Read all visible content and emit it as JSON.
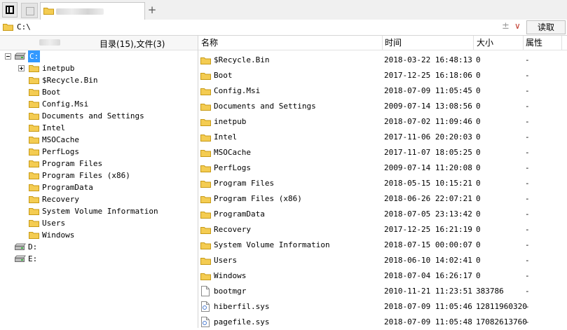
{
  "address": {
    "path": "C:\\",
    "read_button": "读取",
    "sort_glyph": "±",
    "dropdown_glyph": "∨"
  },
  "tabs": {
    "new_tab": "+"
  },
  "left_pane": {
    "summary": "目录(15),文件(3)",
    "tree": [
      {
        "label": "C:",
        "type": "drive",
        "level": 0,
        "expander": "minus",
        "selected": true
      },
      {
        "label": "inetpub",
        "type": "folder",
        "level": 1,
        "expander": "plus"
      },
      {
        "label": "$Recycle.Bin",
        "type": "folder",
        "level": 1
      },
      {
        "label": "Boot",
        "type": "folder",
        "level": 1
      },
      {
        "label": "Config.Msi",
        "type": "folder",
        "level": 1
      },
      {
        "label": "Documents and Settings",
        "type": "folder",
        "level": 1
      },
      {
        "label": "Intel",
        "type": "folder",
        "level": 1
      },
      {
        "label": "MSOCache",
        "type": "folder",
        "level": 1
      },
      {
        "label": "PerfLogs",
        "type": "folder",
        "level": 1
      },
      {
        "label": "Program Files",
        "type": "folder",
        "level": 1
      },
      {
        "label": "Program Files (x86)",
        "type": "folder",
        "level": 1
      },
      {
        "label": "ProgramData",
        "type": "folder",
        "level": 1
      },
      {
        "label": "Recovery",
        "type": "folder",
        "level": 1
      },
      {
        "label": "System Volume Information",
        "type": "folder",
        "level": 1
      },
      {
        "label": "Users",
        "type": "folder",
        "level": 1
      },
      {
        "label": "Windows",
        "type": "folder",
        "level": 1
      },
      {
        "label": "D:",
        "type": "drive",
        "level": 0
      },
      {
        "label": "E:",
        "type": "drive",
        "level": 0
      }
    ]
  },
  "file_list": {
    "columns": {
      "name": "名称",
      "time": "时间",
      "size": "大小",
      "attr": "属性"
    },
    "rows": [
      {
        "name": "$Recycle.Bin",
        "time": "2018-03-22 16:48:13",
        "size": "0",
        "attr": "-",
        "type": "folder"
      },
      {
        "name": "Boot",
        "time": "2017-12-25 16:18:06",
        "size": "0",
        "attr": "-",
        "type": "folder"
      },
      {
        "name": "Config.Msi",
        "time": "2018-07-09 11:05:45",
        "size": "0",
        "attr": "-",
        "type": "folder"
      },
      {
        "name": "Documents and Settings",
        "time": "2009-07-14 13:08:56",
        "size": "0",
        "attr": "-",
        "type": "folder"
      },
      {
        "name": "inetpub",
        "time": "2018-07-02 11:09:46",
        "size": "0",
        "attr": "-",
        "type": "folder"
      },
      {
        "name": "Intel",
        "time": "2017-11-06 20:20:03",
        "size": "0",
        "attr": "-",
        "type": "folder"
      },
      {
        "name": "MSOCache",
        "time": "2017-11-07 18:05:25",
        "size": "0",
        "attr": "-",
        "type": "folder"
      },
      {
        "name": "PerfLogs",
        "time": "2009-07-14 11:20:08",
        "size": "0",
        "attr": "-",
        "type": "folder"
      },
      {
        "name": "Program Files",
        "time": "2018-05-15 10:15:21",
        "size": "0",
        "attr": "-",
        "type": "folder"
      },
      {
        "name": "Program Files (x86)",
        "time": "2018-06-26 22:07:21",
        "size": "0",
        "attr": "-",
        "type": "folder"
      },
      {
        "name": "ProgramData",
        "time": "2018-07-05 23:13:42",
        "size": "0",
        "attr": "-",
        "type": "folder"
      },
      {
        "name": "Recovery",
        "time": "2017-12-25 16:21:19",
        "size": "0",
        "attr": "-",
        "type": "folder"
      },
      {
        "name": "System Volume Information",
        "time": "2018-07-15 00:00:07",
        "size": "0",
        "attr": "-",
        "type": "folder"
      },
      {
        "name": "Users",
        "time": "2018-06-10 14:02:41",
        "size": "0",
        "attr": "-",
        "type": "folder"
      },
      {
        "name": "Windows",
        "time": "2018-07-04 16:26:17",
        "size": "0",
        "attr": "-",
        "type": "folder"
      },
      {
        "name": "bootmgr",
        "time": "2010-11-21 11:23:51",
        "size": "383786",
        "attr": "-",
        "type": "file"
      },
      {
        "name": "hiberfil.sys",
        "time": "2018-07-09 11:05:46",
        "size": "12811960320",
        "attr": "-",
        "type": "sysfile"
      },
      {
        "name": "pagefile.sys",
        "time": "2018-07-09 11:05:48",
        "size": "17082613760",
        "attr": "-",
        "type": "sysfile"
      }
    ]
  },
  "colors": {
    "folder": "#f4cc52",
    "folder_stroke": "#c79a16",
    "selection": "#3399ff",
    "dropdown": "#c0392b"
  }
}
